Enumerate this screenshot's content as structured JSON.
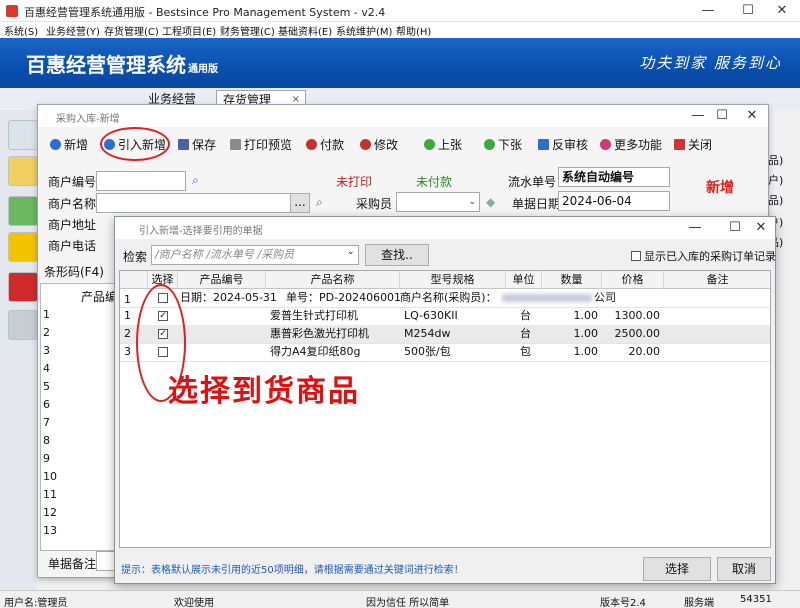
{
  "window": {
    "title": "百惠经营管理系统通用版 - Bestsince Pro Management System - v2.4",
    "min": "—",
    "max": "☐",
    "close": "✕"
  },
  "menu": [
    "系统(S)",
    "业务经营(Y)",
    "存货管理(C)",
    "工程项目(E)",
    "财务管理(C)",
    "基础资料(E)",
    "系统维护(M)",
    "帮助(H)"
  ],
  "banner": {
    "title": "百惠经营管理系统",
    "subtitle": "通用版",
    "slogan": "功夫到家 服务到心",
    "bg_color": "#0a4fae"
  },
  "tabs": {
    "business": "业务经营",
    "inventory": "存货管理",
    "inventory_close": "×"
  },
  "right_strip": [
    "品)",
    "户)",
    "品)",
    "户)",
    "品)"
  ],
  "purchase_window": {
    "title": "采购入库-新增",
    "toolbar": {
      "add": "新增",
      "import_new": "引入新增",
      "save": "保存",
      "print_preview": "打印预览",
      "pay": "付款",
      "edit": "修改",
      "prev": "上张",
      "next": "下张",
      "unreview": "反审核",
      "more": "更多功能",
      "close": "关闭"
    },
    "labels": {
      "merchant_code": "商户编号",
      "merchant_name": "商户名称",
      "merchant_address": "商户地址",
      "merchant_phone": "商户电话",
      "barcode": "条形码(F4)",
      "purchaser": "采购员",
      "serial_no": "流水单号",
      "bill_date": "单据日期",
      "remark": "单据备注",
      "product_code_col": "产品编号"
    },
    "status": {
      "print": "未打印",
      "payment": "未付款",
      "new_badge": "新增"
    },
    "values": {
      "serial_no": "系统自动编号",
      "bill_date": "2024-06-04",
      "browse": "..."
    },
    "row_numbers": [
      "1",
      "2",
      "3",
      "4",
      "5",
      "6",
      "7",
      "8",
      "9",
      "10",
      "11",
      "12",
      "13"
    ]
  },
  "dialog": {
    "title": "引入新增-选择要引用的单据",
    "search_label": "检索",
    "search_placeholder": "/商户名称 /流水单号 /采购员",
    "search_button": "查找..",
    "show_checkbox_label": "显示已入库的采购订单记录",
    "columns": [
      "选择",
      "产品编号",
      "产品名称",
      "型号规格",
      "单位",
      "数量",
      "价格",
      "备注"
    ],
    "group_row": {
      "num": "1",
      "date": "日期：2024-05-31",
      "bill": "单号：PD-202406001",
      "merchant_label": "商户名称(采购员)：",
      "merchant_suffix": "公司"
    },
    "rows": [
      {
        "num": "1",
        "checked": true,
        "name": "爱普生针式打印机",
        "spec": "LQ-630KII",
        "unit": "台",
        "qty": "1.00",
        "price": "1300.00"
      },
      {
        "num": "2",
        "checked": true,
        "name": "惠普彩色激光打印机",
        "spec": "M254dw",
        "unit": "台",
        "qty": "1.00",
        "price": "2500.00"
      },
      {
        "num": "3",
        "checked": false,
        "name": "得力A4复印纸80g",
        "spec": "500张/包",
        "unit": "包",
        "qty": "1.00",
        "price": "20.00"
      }
    ],
    "hint": "提示：表格默认展示未引用的近50项明细，请根据需要通过关键词进行检索！",
    "select_button": "选择",
    "cancel_button": "取消"
  },
  "annotation": "选择到货商品",
  "statusbar": {
    "user": "用户名:管理员",
    "welcome": "欢迎使用",
    "slogan": "因为信任 所以简单",
    "version": "版本号2.4",
    "service": "服务端",
    "port": "54351"
  }
}
